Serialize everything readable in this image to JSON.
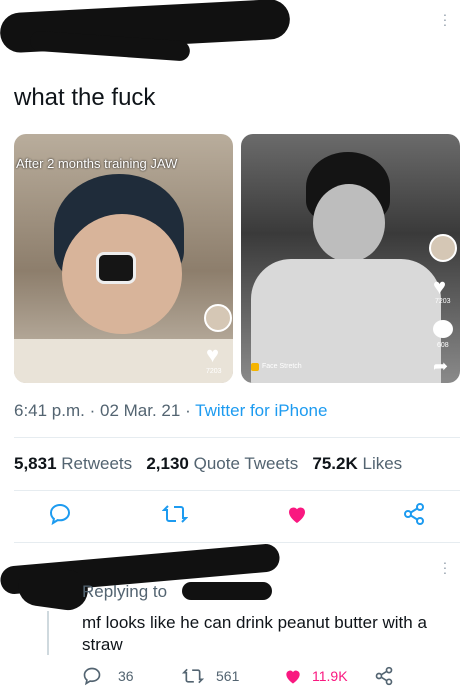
{
  "tweet": {
    "text": "what the fuck",
    "time": "6:41 p.m.",
    "date": "02 Mar. 21",
    "separator": "·",
    "source": "Twitter for iPhone"
  },
  "media": {
    "left": {
      "caption": "After 2 months training JAW",
      "like_count": "7203"
    },
    "right": {
      "tag": "Face Stretch",
      "like_count": "7203",
      "comment_count": "608"
    }
  },
  "stats": {
    "retweets_value": "5,831",
    "retweets_label": "Retweets",
    "quotes_value": "2,130",
    "quotes_label": "Quote Tweets",
    "likes_value": "75.2K",
    "likes_label": "Likes"
  },
  "reply": {
    "replying_to": "Replying to",
    "text": "mf looks like he can drink peanut butter with a straw",
    "reply_count": "36",
    "retweet_count": "561",
    "like_count": "11.9K"
  },
  "colors": {
    "like_active": "#f91880",
    "link": "#1d9bf0",
    "muted": "#536471"
  }
}
